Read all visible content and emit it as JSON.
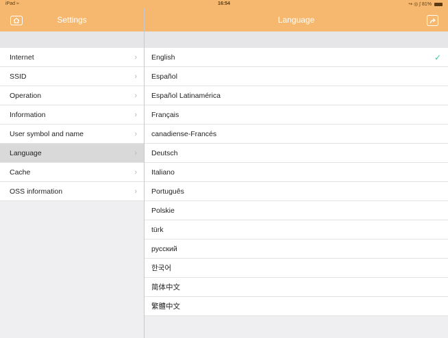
{
  "status_bar": {
    "device": "iPad",
    "time": "16:54",
    "battery": "81%"
  },
  "left_panel": {
    "title": "Settings",
    "home_icon": "home-icon",
    "items": [
      {
        "label": "Internet",
        "selected": false
      },
      {
        "label": "SSID",
        "selected": false
      },
      {
        "label": "Operation",
        "selected": false
      },
      {
        "label": "Information",
        "selected": false
      },
      {
        "label": "User symbol and name",
        "selected": false
      },
      {
        "label": "Language",
        "selected": true
      },
      {
        "label": "Cache",
        "selected": false
      },
      {
        "label": "OSS information",
        "selected": false
      }
    ]
  },
  "right_panel": {
    "title": "Language",
    "share_icon": "share-icon",
    "check_color": "#48c9a3",
    "languages": [
      {
        "label": "English",
        "checked": true
      },
      {
        "label": "Español",
        "checked": false
      },
      {
        "label": "Español Latinamérica",
        "checked": false
      },
      {
        "label": "Français",
        "checked": false
      },
      {
        "label": "canadiense-Francés",
        "checked": false
      },
      {
        "label": "Deutsch",
        "checked": false
      },
      {
        "label": "Italiano",
        "checked": false
      },
      {
        "label": "Português",
        "checked": false
      },
      {
        "label": "Polskie",
        "checked": false
      },
      {
        "label": "türk",
        "checked": false
      },
      {
        "label": "русский",
        "checked": false
      },
      {
        "label": "한국어",
        "checked": false
      },
      {
        "label": "简体中文",
        "checked": false
      },
      {
        "label": "繁體中文",
        "checked": false
      }
    ]
  },
  "colors": {
    "header": "#f6b86f",
    "selected_row": "#d9d9d9"
  }
}
